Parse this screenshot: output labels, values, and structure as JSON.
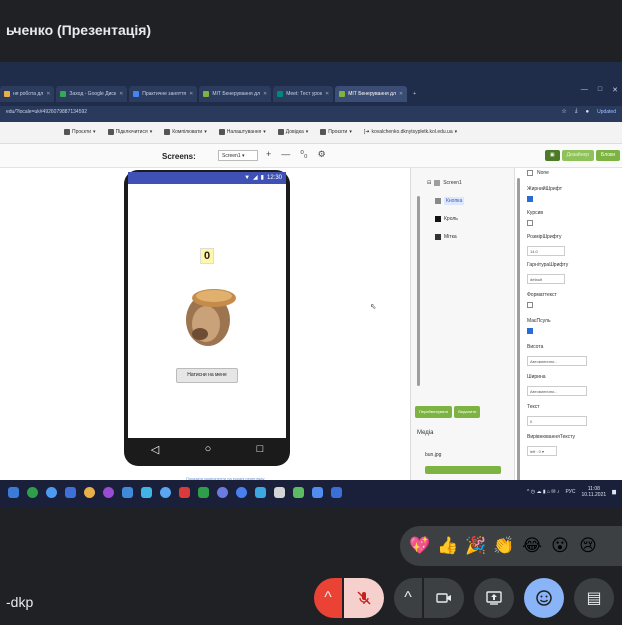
{
  "meet": {
    "title": "ьченко (Презентація)",
    "meeting_code": "-dkp",
    "reactions": [
      "💖",
      "👍",
      "🎉",
      "👏",
      "😂",
      "😮",
      "😢"
    ],
    "controls": {
      "raise": "^",
      "mic": "🎤",
      "more": "^",
      "camera": "📷",
      "present": "⬆",
      "emoji": "☺",
      "captions": "▤"
    }
  },
  "browser": {
    "tabs": [
      {
        "label": "ня робота дл",
        "active": false
      },
      {
        "label": "Заход - Google Диск",
        "active": false
      },
      {
        "label": "Практичне заняття",
        "active": false
      },
      {
        "label": "МІТ Бенерування дл",
        "active": false
      },
      {
        "label": "Meet: Тест урок",
        "active": false
      },
      {
        "label": "МІТ Бенерування дл",
        "active": true
      }
    ],
    "new_tab": "+",
    "window_controls": [
      "—",
      "□",
      "✕"
    ],
    "address": "edu/?locale=uk#4926079887134592",
    "update_label": "Updated"
  },
  "appinventor": {
    "menus": [
      "Проєкти",
      "Підключитися",
      "Компілювати",
      "Налаштування",
      "Довідка",
      "Проєкти"
    ],
    "user_email": "kovalchenko.dknytsypletk.kol.edu.ua",
    "screens_label": "Screens:",
    "screen_select": "Screen1",
    "screen_buttons": [
      "+",
      "—",
      "⁰₀",
      "⚙"
    ],
    "design_buttons": [
      "▣",
      "Дизайнер",
      "Блоки"
    ],
    "phone_time": "12:30",
    "counter_value": "0",
    "click_button_label": "Натисни на мене",
    "nav_icons": [
      "◁",
      "○",
      "□"
    ],
    "viewer_caption": "Показати компоненти на екрані перегляду",
    "components": {
      "tree": [
        "Screen1",
        "Кнопка",
        "Кроль",
        "Мітка"
      ],
      "buttons": [
        "Перейменувати",
        "Видалити"
      ],
      "media_title": "Медіа",
      "media_file": "bun.jpg"
    },
    "properties": {
      "labels": [
        "None",
        "ЖирнийШрифт",
        "Курсив",
        "РозмірШрифту",
        "ГарнітураШрифту",
        "Форматтекст",
        "МаєПсуль",
        "Висота",
        "Ширина",
        "Текст",
        "ВирівнюванняТексту"
      ],
      "font_size": "14.0",
      "font_family": "default",
      "height": "Автоматично...",
      "width": "Автоматично...",
      "text": "0",
      "align": "left : 0 ▾"
    }
  },
  "taskbar": {
    "tray_time": "11:08",
    "tray_date": "10.11.2021",
    "tray_lang": "РУС"
  }
}
